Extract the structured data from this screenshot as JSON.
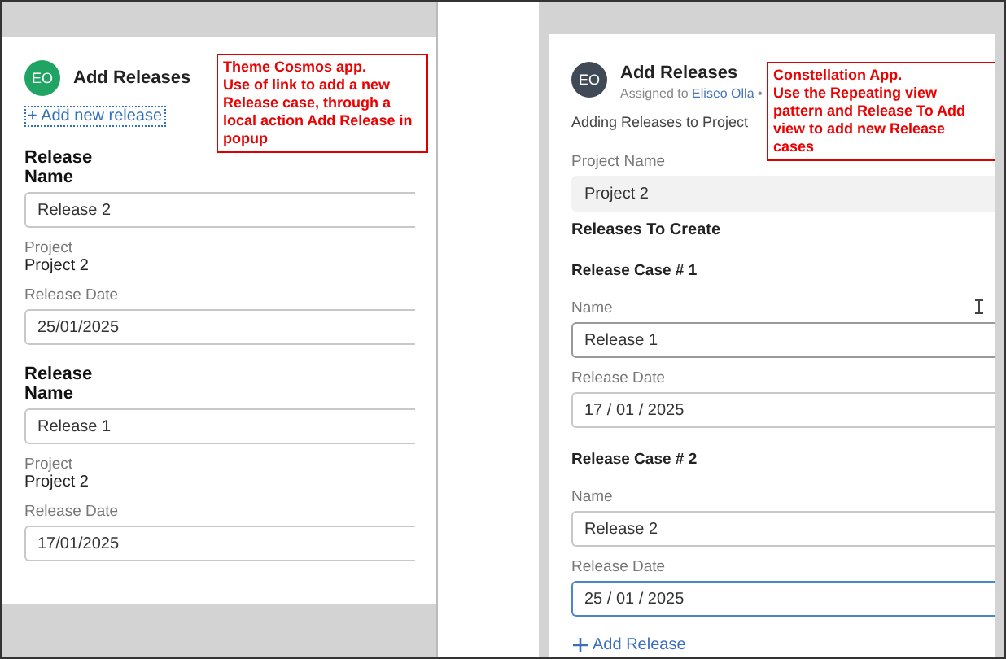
{
  "left": {
    "avatar": "EO",
    "title": "Add Releases",
    "add_link": "+ Add new release",
    "note": "Theme Cosmos app.\nUse of link to add a new\nRelease case, through a\nlocal action Add Release in\npopup",
    "releases": [
      {
        "heading": "Release",
        "name_label": "Name",
        "name_value": "Release 2",
        "project_label": "Project",
        "project_value": "Project 2",
        "date_label": "Release Date",
        "date_value": "25/01/2025"
      },
      {
        "heading": "Release",
        "name_label": "Name",
        "name_value": "Release 1",
        "project_label": "Project",
        "project_value": "Project 2",
        "date_label": "Release Date",
        "date_value": "17/01/2025"
      }
    ]
  },
  "right": {
    "avatar": "EO",
    "title": "Add Releases",
    "assigned_prefix": "Assigned to",
    "assigned_name": "Eliseo Olla",
    "separator": "•",
    "note": "Constellation App.\nUse the Repeating view\npattern and Release To Add\nview to add new Release\ncases",
    "subtitle": "Adding Releases to Project",
    "project_name_label": "Project Name",
    "project_name_value": "Project 2",
    "section_title": "Releases To Create",
    "cases": [
      {
        "title": "Release Case # 1",
        "name_label": "Name",
        "name_value": "Release 1",
        "date_label": "Release Date",
        "date_value": "17 / 01 / 2025",
        "focused": false
      },
      {
        "title": "Release Case # 2",
        "name_label": "Name",
        "name_value": "Release 2",
        "date_label": "Release Date",
        "date_value": "25 / 01 / 2025",
        "focused": true
      }
    ],
    "add_button": "Add Release"
  }
}
